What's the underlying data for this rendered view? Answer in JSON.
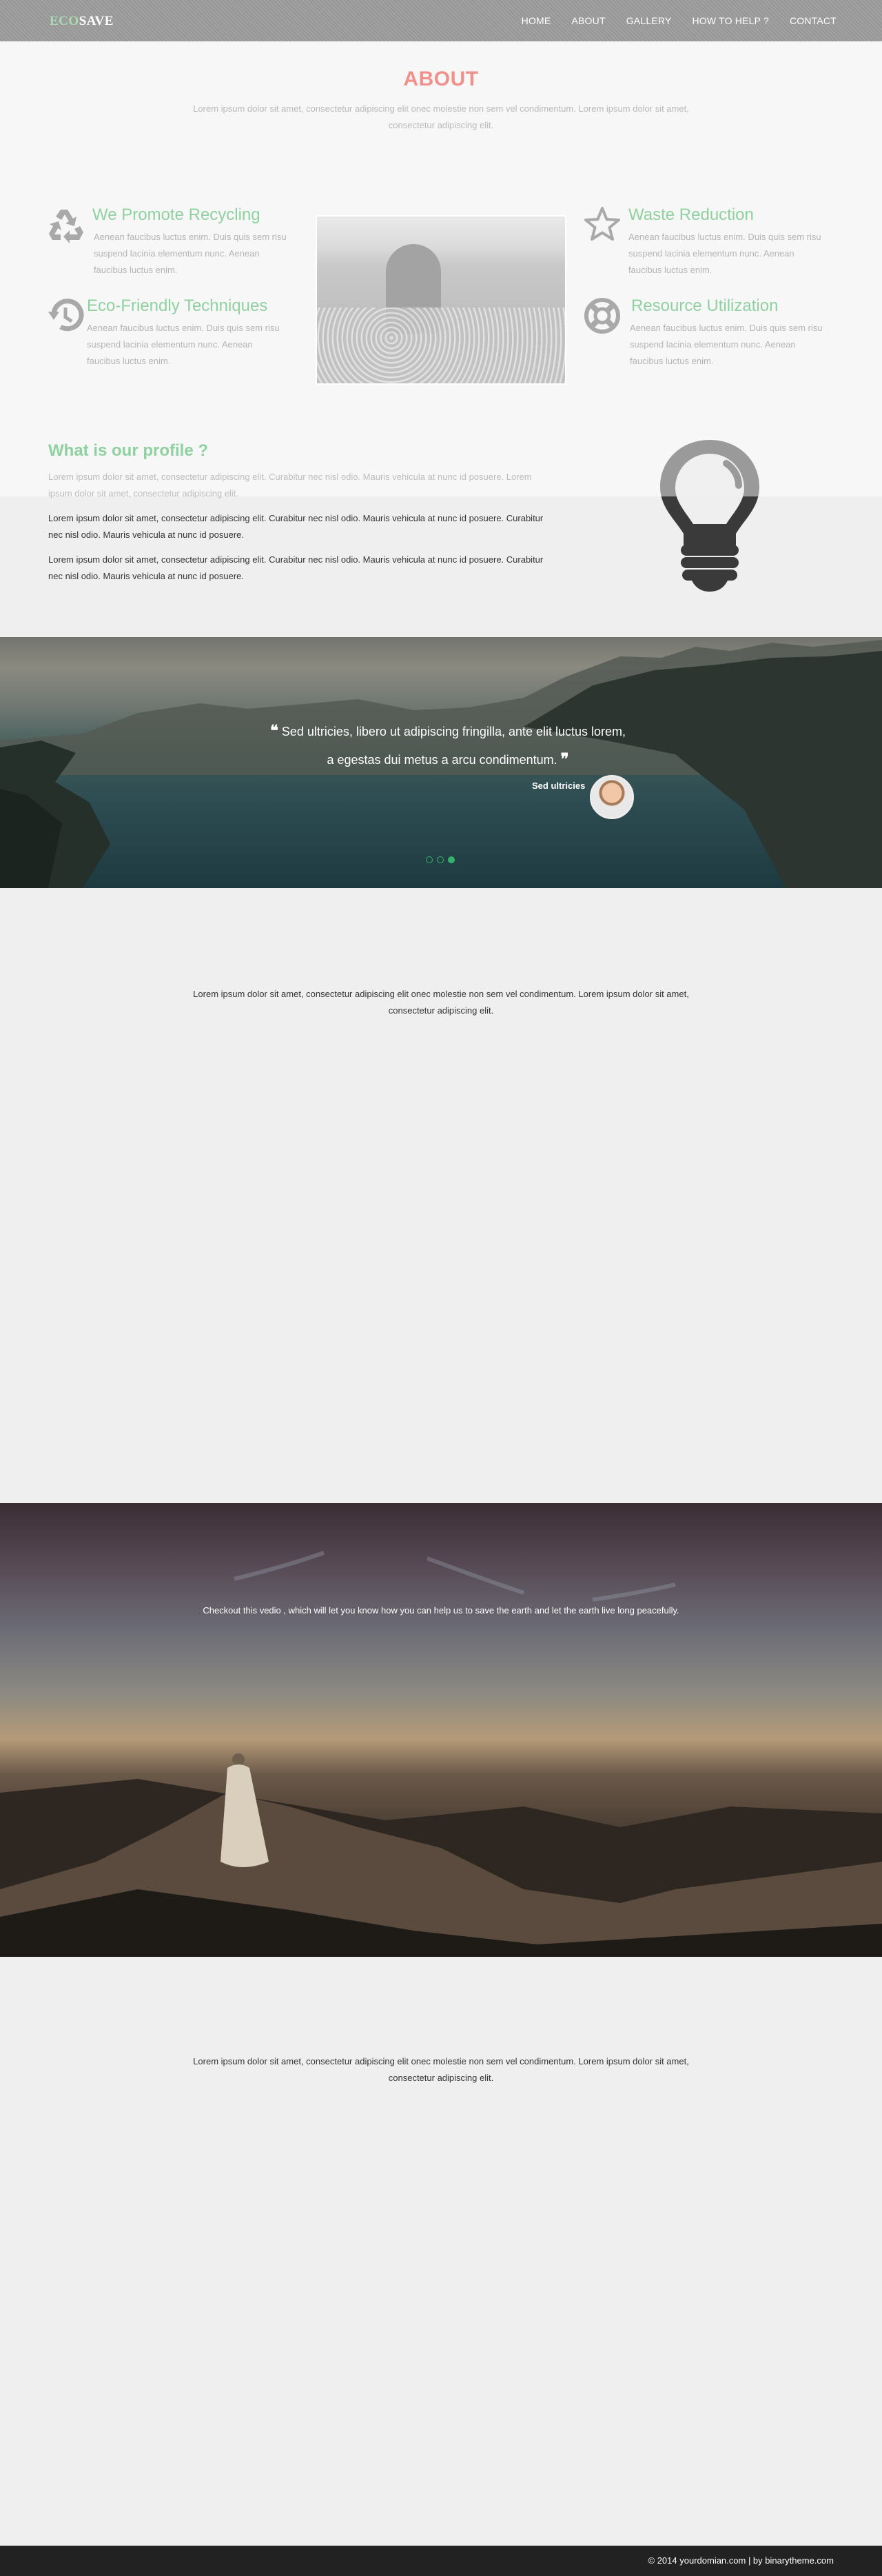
{
  "brand": {
    "prefix": "ECO",
    "suffix": "SAVE"
  },
  "nav": [
    "HOME",
    "ABOUT",
    "GALLERY",
    "HOW TO HELP ?",
    "CONTACT"
  ],
  "about": {
    "title": "ABOUT",
    "subtitle": "Lorem ipsum dolor sit amet, consectetur adipiscing elit onec molestie non sem vel condimentum. Lorem ipsum dolor sit amet, consectetur adipiscing elit.",
    "features": [
      {
        "icon": "recycle-icon",
        "title": "We Promote Recycling",
        "text": "Aenean faucibus luctus enim. Duis quis sem risu suspend lacinia elementum nunc. Aenean faucibus luctus enim."
      },
      {
        "icon": "history-icon",
        "title": "Eco-Friendly Techniques",
        "text": "Aenean faucibus luctus enim. Duis quis sem risu suspend lacinia elementum nunc. Aenean faucibus luctus enim."
      },
      {
        "icon": "star-icon",
        "title": "Waste Reduction",
        "text": "Aenean faucibus luctus enim. Duis quis sem risu suspend lacinia elementum nunc. Aenean faucibus luctus enim."
      },
      {
        "icon": "life-ring-icon",
        "title": "Resource Utilization",
        "text": "Aenean faucibus luctus enim. Duis quis sem risu suspend lacinia elementum nunc. Aenean faucibus luctus enim."
      }
    ]
  },
  "profile": {
    "title": "What is our profile ?",
    "paragraphs": [
      "Lorem ipsum dolor sit amet, consectetur adipiscing elit. Curabitur nec nisl odio. Mauris vehicula at nunc id posuere. Lorem ipsum dolor sit amet, consectetur adipiscing elit.",
      "Lorem ipsum dolor sit amet, consectetur adipiscing elit. Curabitur nec nisl odio. Mauris vehicula at nunc id posuere. Curabitur nec nisl odio. Mauris vehicula at nunc id posuere.",
      "Lorem ipsum dolor sit amet, consectetur adipiscing elit. Curabitur nec nisl odio. Mauris vehicula at nunc id posuere. Curabitur nec nisl odio. Mauris vehicula at nunc id posuere."
    ]
  },
  "testimonial": {
    "quote": "Sed ultricies, libero ut adipiscing fringilla, ante elit luctus lorem, a egestas dui metus a arcu condimentum.",
    "name": "Sed ultricies",
    "slides": 3,
    "active_slide": 3,
    "accent": "#33b36a"
  },
  "text_section_1": "Lorem ipsum dolor sit amet, consectetur adipiscing elit onec molestie non sem vel condimentum. Lorem ipsum dolor sit amet, consectetur adipiscing elit.",
  "video": {
    "caption": "Checkout this vedio , which will let you know how you can help us to save the earth and let the earth live long peacefully."
  },
  "text_section_2": "Lorem ipsum dolor sit amet, consectetur adipiscing elit onec molestie non sem vel condimentum. Lorem ipsum dolor sit amet, consectetur adipiscing elit.",
  "footer": {
    "text": "© 2014 yourdomian.com | by binarytheme.com"
  },
  "colors": {
    "accent_green": "#8fd1a0",
    "about_title": "#f0928b",
    "navbar": "#9c9c9c",
    "footer": "#222222"
  }
}
